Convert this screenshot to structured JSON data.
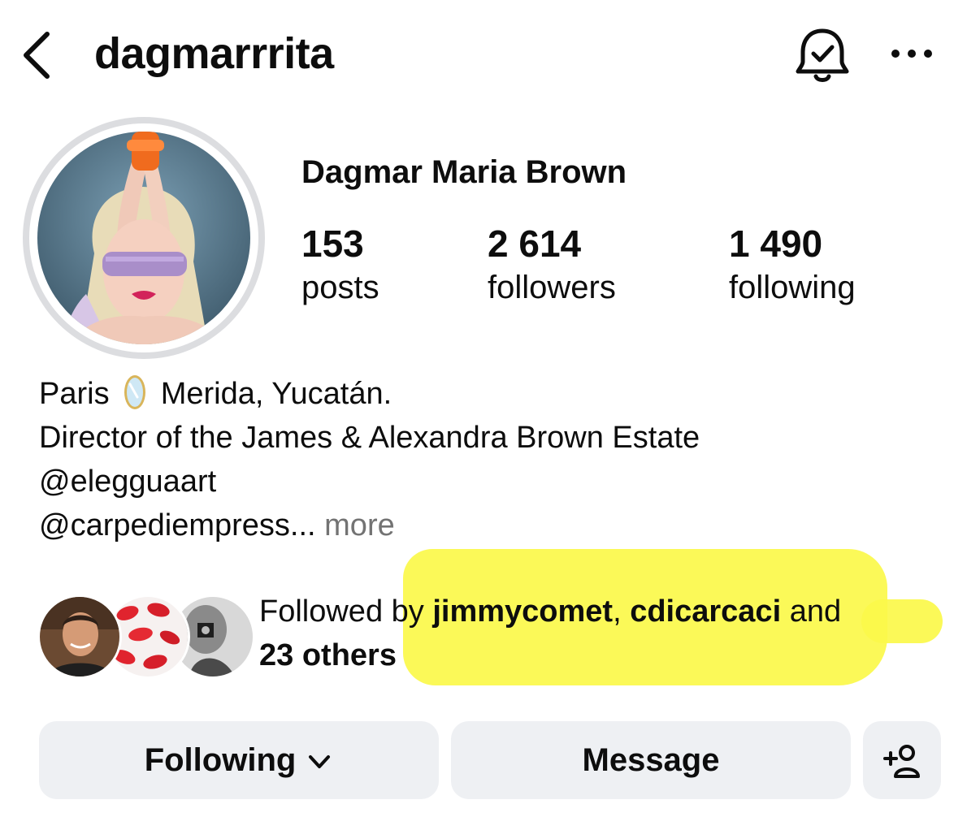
{
  "header": {
    "username": "dagmarrrita"
  },
  "profile": {
    "full_name": "Dagmar Maria Brown",
    "stats": {
      "posts": {
        "value": "153",
        "label": "posts"
      },
      "followers": {
        "value": "2 614",
        "label": "followers"
      },
      "following": {
        "value": "1 490",
        "label": "following"
      }
    },
    "bio": {
      "line1_start": "Paris",
      "line1_emoji": "mirror-emoji",
      "line1_end": "Merida, Yucatán.",
      "line2": "Director of the James & Alexandra Brown Estate",
      "line3": "@elegguaart",
      "line4": "@carpediempress...",
      "more": "more"
    }
  },
  "followed_by": {
    "prefix": "Followed by",
    "user1": "jimmycomet",
    "separator": ",",
    "user2": "cdicarcaci",
    "conjunction": "and",
    "others": "23 others"
  },
  "actions": {
    "following_label": "Following",
    "message_label": "Message"
  },
  "colors": {
    "button_bg": "#eef0f3",
    "highlight": "#fbf84a",
    "muted_text": "#737373",
    "avatar_ring": "#dcdde0"
  }
}
